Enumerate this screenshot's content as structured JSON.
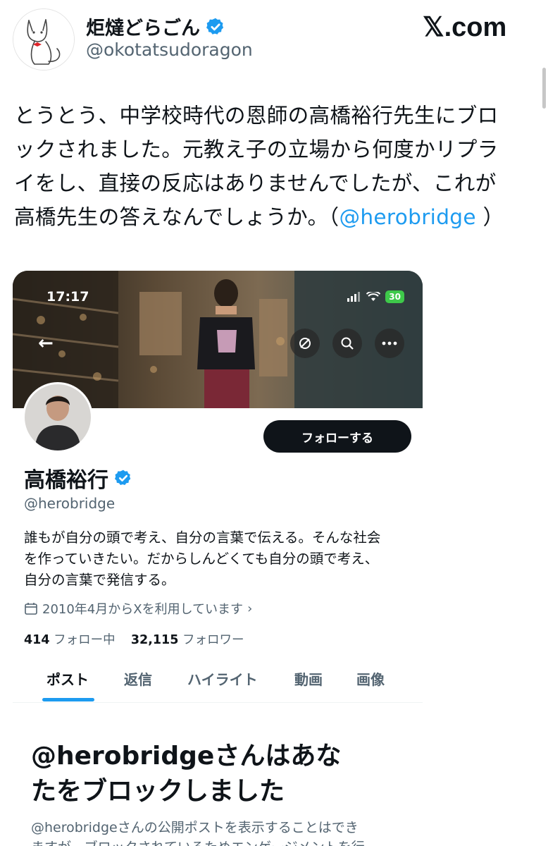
{
  "tweet": {
    "author_name": "炬燵どらごん",
    "author_handle": "@okotatsudoragon",
    "site": "𝕏.com",
    "text_lines": [
      "とうとう、中学校時代の恩師の高橋裕行先生にブロ",
      "ックされました。元教え子の立場から何度かリプラ",
      "イをし、直接の反応はありませんでしたが、これが"
    ],
    "text_last_prefix": "高橋先生の答えなんでしょうか。（",
    "text_last_mention": "@herobridge",
    "text_last_suffix": " ）"
  },
  "embedded_profile": {
    "status_time": "17:17",
    "battery": "30",
    "follow_label": "フォローする",
    "name": "高橋裕行",
    "handle": "@herobridge",
    "bio_lines": [
      "誰もが自分の頭で考え、自分の言葉で伝える。そんな社会",
      "を作っていきたい。だからしんどくても自分の頭で考え、",
      "自分の言葉で発信する。"
    ],
    "joined": "2010年4月からXを利用しています",
    "following_count": "414",
    "following_label": "フォロー中",
    "followers_count": "32,115",
    "followers_label": "フォロワー",
    "tabs": [
      "ポスト",
      "返信",
      "ハイライト",
      "動画",
      "画像"
    ],
    "blocked_title_lines": [
      "@herobridgeさんはあな",
      "たをブロックしました"
    ],
    "blocked_body_lines": [
      "@herobridgeさんの公開ポストを表示することはでき",
      "ますが、ブロックされているためエンゲージメントを行"
    ]
  },
  "colors": {
    "accent": "#1d9bf0",
    "text": "#0f1419",
    "muted": "#536471",
    "follow_button": "#0f1419"
  }
}
